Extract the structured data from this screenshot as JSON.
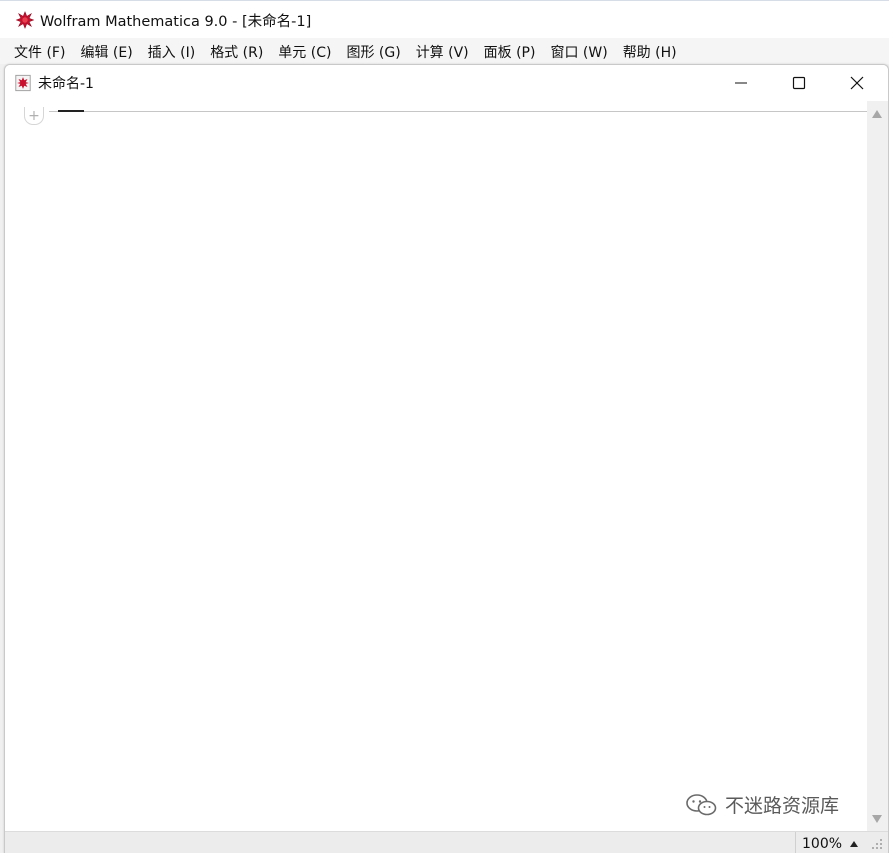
{
  "app": {
    "title": "Wolfram Mathematica 9.0 - [未命名-1]",
    "icon": "mathematica-star-icon",
    "accent_color": "#c8102e"
  },
  "menubar": {
    "items": [
      {
        "label": "文件 (F)"
      },
      {
        "label": "编辑 (E)"
      },
      {
        "label": "插入 (I)"
      },
      {
        "label": "格式 (R)"
      },
      {
        "label": "单元 (C)"
      },
      {
        "label": "图形 (G)"
      },
      {
        "label": "计算 (V)"
      },
      {
        "label": "面板 (P)"
      },
      {
        "label": "窗口 (W)"
      },
      {
        "label": "帮助 (H)"
      }
    ]
  },
  "document": {
    "title": "未命名-1",
    "icon": "notebook-icon",
    "controls": {
      "minimize": "minimize-icon",
      "maximize": "maximize-icon",
      "close": "close-icon"
    },
    "cell_insert_symbol": "+"
  },
  "watermark": {
    "text": "不迷路资源库",
    "icon": "wechat-icon"
  },
  "statusbar": {
    "zoom": "100%"
  }
}
